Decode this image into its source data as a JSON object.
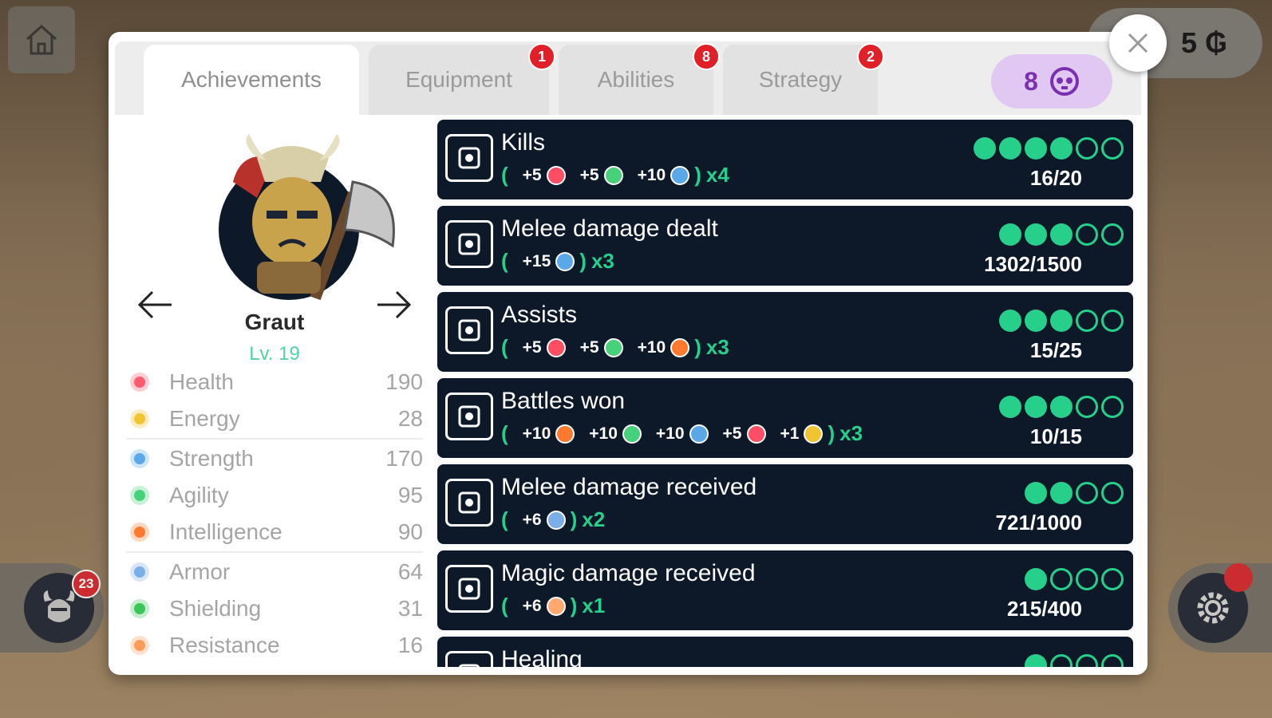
{
  "hud": {
    "gold": "5 ₲",
    "hero_badge": "23"
  },
  "tabs": [
    {
      "label": "Achievements",
      "badge": ""
    },
    {
      "label": "Equipment",
      "badge": "1"
    },
    {
      "label": "Abilities",
      "badge": "8"
    },
    {
      "label": "Strategy",
      "badge": "2"
    }
  ],
  "points": "8",
  "hero": {
    "name": "Graut",
    "level": "Lv. 19",
    "stats": [
      {
        "label": "Health",
        "value": "190",
        "icon": "heart-icon",
        "color": "#ff5a6e"
      },
      {
        "label": "Energy",
        "value": "28",
        "icon": "lightning-icon",
        "color": "#f2c431"
      },
      {
        "label": "Strength",
        "value": "170",
        "icon": "fist-icon",
        "color": "#5ba8e8"
      },
      {
        "label": "Agility",
        "value": "95",
        "icon": "feather-icon",
        "color": "#46d17a"
      },
      {
        "label": "Intelligence",
        "value": "90",
        "icon": "book-icon",
        "color": "#ff7a2f"
      },
      {
        "label": "Armor",
        "value": "64",
        "icon": "shield-icon",
        "color": "#7aaee8"
      },
      {
        "label": "Shielding",
        "value": "31",
        "icon": "green-shield-icon",
        "color": "#3cc65a"
      },
      {
        "label": "Resistance",
        "value": "16",
        "icon": "orange-shield-icon",
        "color": "#ff9b5a"
      }
    ]
  },
  "achievements": [
    {
      "title": "Kills",
      "icon": "scroll-icon",
      "rewards": [
        {
          "v": "+5",
          "c": "#ff4d63"
        },
        {
          "v": "+5",
          "c": "#46d17a"
        },
        {
          "v": "+10",
          "c": "#5ba8e8"
        }
      ],
      "mult": "x4",
      "progress": "16/20",
      "done": 4,
      "total": 6
    },
    {
      "title": "Melee damage dealt",
      "icon": "claw-icon",
      "rewards": [
        {
          "v": "+15",
          "c": "#5ba8e8"
        }
      ],
      "mult": "x3",
      "progress": "1302/1500",
      "done": 3,
      "total": 5
    },
    {
      "title": "Assists",
      "icon": "group-icon",
      "rewards": [
        {
          "v": "+5",
          "c": "#ff4d63"
        },
        {
          "v": "+5",
          "c": "#46d17a"
        },
        {
          "v": "+10",
          "c": "#ff7a2f"
        }
      ],
      "mult": "x3",
      "progress": "15/25",
      "done": 3,
      "total": 5
    },
    {
      "title": "Battles won",
      "icon": "laurel-icon",
      "rewards": [
        {
          "v": "+10",
          "c": "#ff7a2f"
        },
        {
          "v": "+10",
          "c": "#46d17a"
        },
        {
          "v": "+10",
          "c": "#5ba8e8"
        },
        {
          "v": "+5",
          "c": "#ff4d63"
        },
        {
          "v": "+1",
          "c": "#f2c431"
        }
      ],
      "mult": "x3",
      "progress": "10/15",
      "done": 3,
      "total": 5
    },
    {
      "title": "Melee damage received",
      "icon": "armor-icon",
      "rewards": [
        {
          "v": "+6",
          "c": "#7aaee8"
        }
      ],
      "mult": "x2",
      "progress": "721/1000",
      "done": 2,
      "total": 4
    },
    {
      "title": "Magic damage received",
      "icon": "robe-icon",
      "rewards": [
        {
          "v": "+6",
          "c": "#ffa870"
        }
      ],
      "mult": "x1",
      "progress": "215/400",
      "done": 1,
      "total": 4
    },
    {
      "title": "Healing",
      "icon": "healing-icon",
      "rewards": [],
      "mult": "",
      "progress": "",
      "done": 1,
      "total": 4
    }
  ]
}
